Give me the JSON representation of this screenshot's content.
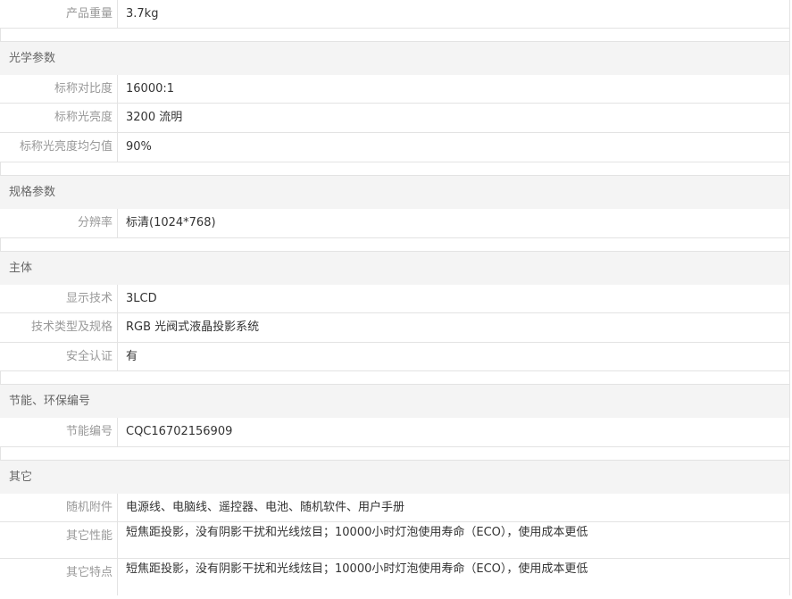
{
  "top_row": {
    "label": "产品重量",
    "value": "3.7kg"
  },
  "sections": [
    {
      "title": "光学参数",
      "rows": [
        {
          "label": "标称对比度",
          "value": "16000:1"
        },
        {
          "label": "标称光亮度",
          "value": "3200 流明"
        },
        {
          "label": "标称光亮度均匀值",
          "value": "90%"
        }
      ]
    },
    {
      "title": "规格参数",
      "rows": [
        {
          "label": "分辨率",
          "value": "标清(1024*768)"
        }
      ]
    },
    {
      "title": "主体",
      "rows": [
        {
          "label": "显示技术",
          "value": "3LCD"
        },
        {
          "label": "技术类型及规格",
          "value": "RGB 光阀式液晶投影系统"
        },
        {
          "label": "安全认证",
          "value": "有"
        }
      ]
    },
    {
      "title": "节能、环保编号",
      "rows": [
        {
          "label": "节能编号",
          "value": "CQC16702156909"
        }
      ]
    },
    {
      "title": "其它",
      "rows": [
        {
          "label": "随机附件",
          "value": "电源线、电脑线、遥控器、电池、随机软件、用户手册"
        },
        {
          "label": "其它性能",
          "value": "短焦距投影，没有阴影干扰和光线炫目；10000小时灯泡使用寿命（ECO），使用成本更低"
        },
        {
          "label": "其它特点",
          "value": "短焦距投影，没有阴影干扰和光线炫目；10000小时灯泡使用寿命（ECO），使用成本更低"
        }
      ]
    }
  ]
}
